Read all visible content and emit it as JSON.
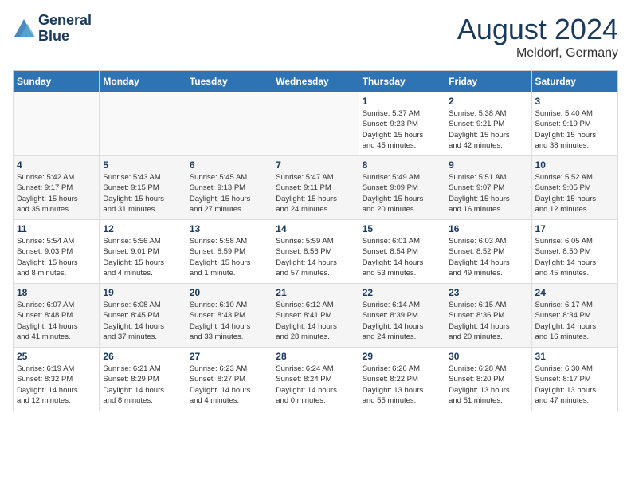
{
  "header": {
    "logo_line1": "General",
    "logo_line2": "Blue",
    "month": "August 2024",
    "location": "Meldorf, Germany"
  },
  "weekdays": [
    "Sunday",
    "Monday",
    "Tuesday",
    "Wednesday",
    "Thursday",
    "Friday",
    "Saturday"
  ],
  "weeks": [
    [
      {
        "day": "",
        "info": ""
      },
      {
        "day": "",
        "info": ""
      },
      {
        "day": "",
        "info": ""
      },
      {
        "day": "",
        "info": ""
      },
      {
        "day": "1",
        "info": "Sunrise: 5:37 AM\nSunset: 9:23 PM\nDaylight: 15 hours\nand 45 minutes."
      },
      {
        "day": "2",
        "info": "Sunrise: 5:38 AM\nSunset: 9:21 PM\nDaylight: 15 hours\nand 42 minutes."
      },
      {
        "day": "3",
        "info": "Sunrise: 5:40 AM\nSunset: 9:19 PM\nDaylight: 15 hours\nand 38 minutes."
      }
    ],
    [
      {
        "day": "4",
        "info": "Sunrise: 5:42 AM\nSunset: 9:17 PM\nDaylight: 15 hours\nand 35 minutes."
      },
      {
        "day": "5",
        "info": "Sunrise: 5:43 AM\nSunset: 9:15 PM\nDaylight: 15 hours\nand 31 minutes."
      },
      {
        "day": "6",
        "info": "Sunrise: 5:45 AM\nSunset: 9:13 PM\nDaylight: 15 hours\nand 27 minutes."
      },
      {
        "day": "7",
        "info": "Sunrise: 5:47 AM\nSunset: 9:11 PM\nDaylight: 15 hours\nand 24 minutes."
      },
      {
        "day": "8",
        "info": "Sunrise: 5:49 AM\nSunset: 9:09 PM\nDaylight: 15 hours\nand 20 minutes."
      },
      {
        "day": "9",
        "info": "Sunrise: 5:51 AM\nSunset: 9:07 PM\nDaylight: 15 hours\nand 16 minutes."
      },
      {
        "day": "10",
        "info": "Sunrise: 5:52 AM\nSunset: 9:05 PM\nDaylight: 15 hours\nand 12 minutes."
      }
    ],
    [
      {
        "day": "11",
        "info": "Sunrise: 5:54 AM\nSunset: 9:03 PM\nDaylight: 15 hours\nand 8 minutes."
      },
      {
        "day": "12",
        "info": "Sunrise: 5:56 AM\nSunset: 9:01 PM\nDaylight: 15 hours\nand 4 minutes."
      },
      {
        "day": "13",
        "info": "Sunrise: 5:58 AM\nSunset: 8:59 PM\nDaylight: 15 hours\nand 1 minute."
      },
      {
        "day": "14",
        "info": "Sunrise: 5:59 AM\nSunset: 8:56 PM\nDaylight: 14 hours\nand 57 minutes."
      },
      {
        "day": "15",
        "info": "Sunrise: 6:01 AM\nSunset: 8:54 PM\nDaylight: 14 hours\nand 53 minutes."
      },
      {
        "day": "16",
        "info": "Sunrise: 6:03 AM\nSunset: 8:52 PM\nDaylight: 14 hours\nand 49 minutes."
      },
      {
        "day": "17",
        "info": "Sunrise: 6:05 AM\nSunset: 8:50 PM\nDaylight: 14 hours\nand 45 minutes."
      }
    ],
    [
      {
        "day": "18",
        "info": "Sunrise: 6:07 AM\nSunset: 8:48 PM\nDaylight: 14 hours\nand 41 minutes."
      },
      {
        "day": "19",
        "info": "Sunrise: 6:08 AM\nSunset: 8:45 PM\nDaylight: 14 hours\nand 37 minutes."
      },
      {
        "day": "20",
        "info": "Sunrise: 6:10 AM\nSunset: 8:43 PM\nDaylight: 14 hours\nand 33 minutes."
      },
      {
        "day": "21",
        "info": "Sunrise: 6:12 AM\nSunset: 8:41 PM\nDaylight: 14 hours\nand 28 minutes."
      },
      {
        "day": "22",
        "info": "Sunrise: 6:14 AM\nSunset: 8:39 PM\nDaylight: 14 hours\nand 24 minutes."
      },
      {
        "day": "23",
        "info": "Sunrise: 6:15 AM\nSunset: 8:36 PM\nDaylight: 14 hours\nand 20 minutes."
      },
      {
        "day": "24",
        "info": "Sunrise: 6:17 AM\nSunset: 8:34 PM\nDaylight: 14 hours\nand 16 minutes."
      }
    ],
    [
      {
        "day": "25",
        "info": "Sunrise: 6:19 AM\nSunset: 8:32 PM\nDaylight: 14 hours\nand 12 minutes."
      },
      {
        "day": "26",
        "info": "Sunrise: 6:21 AM\nSunset: 8:29 PM\nDaylight: 14 hours\nand 8 minutes."
      },
      {
        "day": "27",
        "info": "Sunrise: 6:23 AM\nSunset: 8:27 PM\nDaylight: 14 hours\nand 4 minutes."
      },
      {
        "day": "28",
        "info": "Sunrise: 6:24 AM\nSunset: 8:24 PM\nDaylight: 14 hours\nand 0 minutes."
      },
      {
        "day": "29",
        "info": "Sunrise: 6:26 AM\nSunset: 8:22 PM\nDaylight: 13 hours\nand 55 minutes."
      },
      {
        "day": "30",
        "info": "Sunrise: 6:28 AM\nSunset: 8:20 PM\nDaylight: 13 hours\nand 51 minutes."
      },
      {
        "day": "31",
        "info": "Sunrise: 6:30 AM\nSunset: 8:17 PM\nDaylight: 13 hours\nand 47 minutes."
      }
    ]
  ]
}
